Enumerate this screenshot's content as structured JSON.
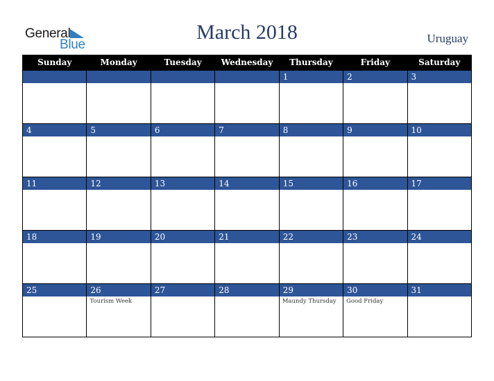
{
  "logo": {
    "general": "General",
    "blue": "Blue"
  },
  "title": "March 2018",
  "country": "Uruguay",
  "weekdays": [
    "Sunday",
    "Monday",
    "Tuesday",
    "Wednesday",
    "Thursday",
    "Friday",
    "Saturday"
  ],
  "weeks": [
    [
      {
        "day": "",
        "event": ""
      },
      {
        "day": "",
        "event": ""
      },
      {
        "day": "",
        "event": ""
      },
      {
        "day": "",
        "event": ""
      },
      {
        "day": "1",
        "event": ""
      },
      {
        "day": "2",
        "event": ""
      },
      {
        "day": "3",
        "event": ""
      }
    ],
    [
      {
        "day": "4",
        "event": ""
      },
      {
        "day": "5",
        "event": ""
      },
      {
        "day": "6",
        "event": ""
      },
      {
        "day": "7",
        "event": ""
      },
      {
        "day": "8",
        "event": ""
      },
      {
        "day": "9",
        "event": ""
      },
      {
        "day": "10",
        "event": ""
      }
    ],
    [
      {
        "day": "11",
        "event": ""
      },
      {
        "day": "12",
        "event": ""
      },
      {
        "day": "13",
        "event": ""
      },
      {
        "day": "14",
        "event": ""
      },
      {
        "day": "15",
        "event": ""
      },
      {
        "day": "16",
        "event": ""
      },
      {
        "day": "17",
        "event": ""
      }
    ],
    [
      {
        "day": "18",
        "event": ""
      },
      {
        "day": "19",
        "event": ""
      },
      {
        "day": "20",
        "event": ""
      },
      {
        "day": "21",
        "event": ""
      },
      {
        "day": "22",
        "event": ""
      },
      {
        "day": "23",
        "event": ""
      },
      {
        "day": "24",
        "event": ""
      }
    ],
    [
      {
        "day": "25",
        "event": ""
      },
      {
        "day": "26",
        "event": "Tourism Week"
      },
      {
        "day": "27",
        "event": ""
      },
      {
        "day": "28",
        "event": ""
      },
      {
        "day": "29",
        "event": "Maundy Thursday"
      },
      {
        "day": "30",
        "event": "Good Friday"
      },
      {
        "day": "31",
        "event": ""
      }
    ]
  ],
  "colors": {
    "header_bg": "#000000",
    "day_bar": "#2d5597",
    "title": "#253d66",
    "logo_blue": "#2f7fc1"
  }
}
